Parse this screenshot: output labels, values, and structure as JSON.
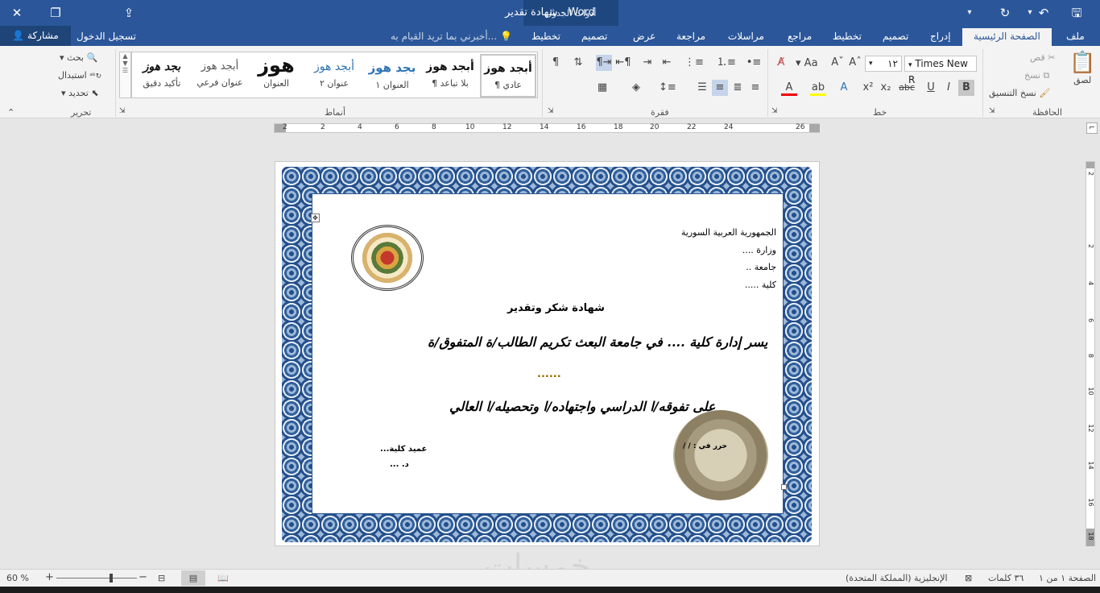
{
  "titlebar": {
    "doc_title": "شهادة تقدير - Word",
    "table_tools": "أدوات الجدول"
  },
  "tabs": [
    {
      "label": "ملف",
      "active": false
    },
    {
      "label": "الصفحة الرئيسية",
      "active": true
    },
    {
      "label": "إدراج",
      "active": false
    },
    {
      "label": "تصميم",
      "active": false
    },
    {
      "label": "تخطيط",
      "active": false
    },
    {
      "label": "مراجع",
      "active": false
    },
    {
      "label": "مراسلات",
      "active": false
    },
    {
      "label": "مراجعة",
      "active": false
    },
    {
      "label": "عرض",
      "active": false
    },
    {
      "label": "تصميم",
      "active": false
    },
    {
      "label": "تخطيط",
      "active": false
    }
  ],
  "tell_me": "أخبرني بما تريد القيام به...",
  "sign_in": "تسجيل الدخول",
  "share": "مشاركة",
  "clipboard": {
    "paste": "لصق",
    "cut": "قص",
    "copy": "نسخ",
    "format_painter": "نسخ التنسيق",
    "group": "الحافظة"
  },
  "font": {
    "name": "Times New R",
    "size": "١٢",
    "bold": "B",
    "italic": "I",
    "underline": "U",
    "strike": "abc",
    "subscript": "x₂",
    "superscript": "x²",
    "font_color_letter": "A",
    "change_case": "Aa",
    "group": "خط"
  },
  "paragraph": {
    "group": "فقرة"
  },
  "styles": {
    "items": [
      {
        "preview": "أبجد هوز",
        "name": "¶ عادي"
      },
      {
        "preview": "أبجد هوز",
        "name": "¶ بلا تباعد"
      },
      {
        "preview": "بجد هوز",
        "name": "العنوان ١"
      },
      {
        "preview": "أبجد هوز",
        "name": "عنوان ٢"
      },
      {
        "preview": "هوز",
        "name": "العنوان"
      },
      {
        "preview": "أبجد هوز",
        "name": "عنوان فرعي"
      },
      {
        "preview": "بجد هوز",
        "name": "تأكيد دقيق"
      }
    ],
    "group": "أنماط"
  },
  "editing": {
    "find": "بحث",
    "replace": "استبدال",
    "select": "تحديد",
    "group": "تحرير"
  },
  "ruler": {
    "h_ticks": [
      "2",
      "2",
      "4",
      "6",
      "8",
      "10",
      "12",
      "14",
      "16",
      "18",
      "20",
      "22",
      "24",
      "26"
    ],
    "v_ticks": [
      "2",
      "2",
      "4",
      "6",
      "8",
      "10",
      "12",
      "14",
      "16",
      "18"
    ]
  },
  "document": {
    "header_lines": [
      "الجمهورية العربية السورية",
      "وزارة ....",
      "جامعة ..",
      "كلية ....."
    ],
    "title": "شهادة شكر وتقدير",
    "line1": "يسر إدارة كلية .... في جامعة البعث تكريم الطالب/ة المتفوق/ة",
    "dots": "......",
    "line2": "على تفوقه/ا الدراسي واجتهاده/ا وتحصيله/ا العالي",
    "signature_title": "عميد كلية...",
    "signature_name": "د. ...",
    "date_line": "حرر في : /   /",
    "logo_label": "university-logo"
  },
  "status": {
    "page": "الصفحة ١ من ١",
    "words": "٣٦ كلمات",
    "language": "الإنجليزية (المملكة المتحدة)",
    "zoom": "60 %",
    "zoom_value_percent": 60
  },
  "watermark": "خمسات",
  "colors": {
    "word_blue": "#2b579a",
    "ribbon_bg": "#f3f3f3",
    "frame_blue": "#244f8c",
    "table_tools_bg": "#1f477f"
  }
}
